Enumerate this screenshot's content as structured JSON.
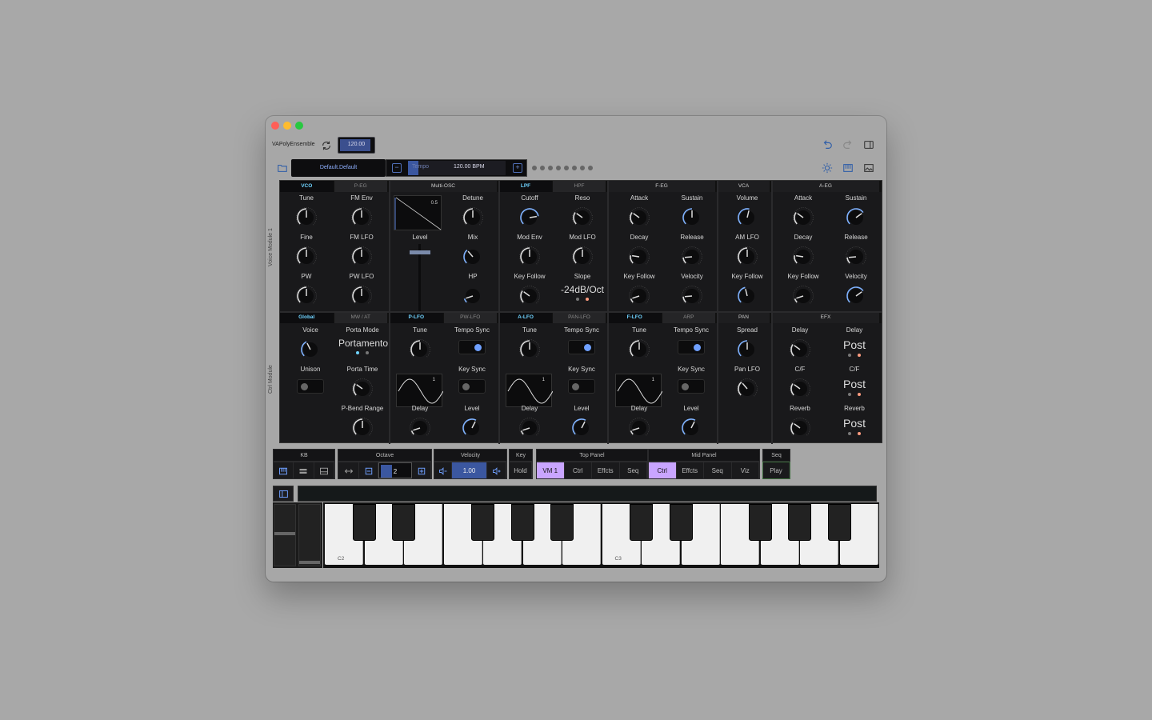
{
  "window": {
    "app_name": "VAPolyEnsemble",
    "tempo_value": "120.00",
    "traffic": {
      "close": "#fe5f57",
      "min": "#febc2e",
      "max": "#28c840"
    }
  },
  "preset": {
    "name": "Default.Default"
  },
  "tempo": {
    "label": "Tempo",
    "value": "120.00 BPM",
    "fill": 0.1
  },
  "page_dots": 8,
  "panel": {
    "side_top": "Voice Module 1",
    "side_bottom": "Ctrl Module",
    "sections_top": [
      {
        "tabs": [
          "VCO",
          "P-EG"
        ],
        "active": 0
      },
      {
        "tabs": [
          "Multi-OSC"
        ],
        "active": -1
      },
      {
        "tabs": [
          "LPF",
          "HPF"
        ],
        "active": 0
      },
      {
        "tabs": [
          "F-EG"
        ],
        "active": -1
      },
      {
        "tabs": [
          "VCA"
        ],
        "active": -1
      },
      {
        "tabs": [
          "A-EG"
        ],
        "active": -1
      }
    ],
    "sections_bottom": [
      {
        "tabs": [
          "Global",
          "MW / AT"
        ],
        "active": 0
      },
      {
        "tabs": [
          "P-LFO",
          "PW-LFO"
        ],
        "active": 0
      },
      {
        "tabs": [
          "A-LFO",
          "PAN-LFO"
        ],
        "active": 0
      },
      {
        "tabs": [
          "F-LFO",
          "ARP"
        ],
        "active": 0
      },
      {
        "tabs": [
          "PAN"
        ],
        "active": -1
      },
      {
        "tabs": [
          "EFX"
        ],
        "active": -1
      }
    ],
    "vco": {
      "tune": "Tune",
      "fm_env": "FM Env",
      "fine": "Fine",
      "fm_lfo": "FM LFO",
      "pw": "PW",
      "pw_lfo": "PW LFO"
    },
    "osc": {
      "shape_value": "0.5",
      "detune": "Detune",
      "level": "Level",
      "mix": "Mix",
      "hp": "HP"
    },
    "lpf": {
      "cutoff": "Cutoff",
      "reso": "Reso",
      "mod_env": "Mod Env",
      "mod_lfo": "Mod LFO",
      "key_follow": "Key Follow",
      "slope": "Slope",
      "slope_value": "-24dB/Oct"
    },
    "feg": {
      "attack": "Attack",
      "sustain": "Sustain",
      "decay": "Decay",
      "release": "Release",
      "key_follow": "Key Follow",
      "velocity": "Velocity"
    },
    "vca": {
      "volume": "Volume",
      "am_lfo": "AM LFO",
      "key_follow": "Key Follow"
    },
    "aeg": {
      "attack": "Attack",
      "sustain": "Sustain",
      "decay": "Decay",
      "release": "Release",
      "key_follow": "Key Follow",
      "velocity": "Velocity"
    },
    "global": {
      "voice": "Voice",
      "porta_mode": "Porta Mode",
      "porta_mode_value": "Portamento",
      "unison": "Unison",
      "porta_time": "Porta Time",
      "pbend": "P-Bend Range"
    },
    "plfo": {
      "tune": "Tune",
      "tempo_sync": "Tempo Sync",
      "key_sync": "Key Sync",
      "delay": "Delay",
      "level": "Level",
      "wave_val": "1"
    },
    "alfo": {
      "tune": "Tune",
      "tempo_sync": "Tempo Sync",
      "key_sync": "Key Sync",
      "delay": "Delay",
      "level": "Level",
      "wave_val": "1"
    },
    "flfo": {
      "tune": "Tune",
      "tempo_sync": "Tempo Sync",
      "key_sync": "Key Sync",
      "delay": "Delay",
      "level": "Level",
      "wave_val": "1"
    },
    "pan": {
      "spread": "Spread",
      "pan_lfo": "Pan LFO"
    },
    "efx": {
      "delay": "Delay",
      "delay2": "Delay",
      "delay_val": "Post",
      "cf": "C/F",
      "cf2": "C/F",
      "cf_val": "Post",
      "reverb": "Reverb",
      "reverb2": "Reverb",
      "reverb_val": "Post"
    }
  },
  "bottom": {
    "kb": "KB",
    "octave": "Octave",
    "octave_value": "2",
    "velocity": "Velocity",
    "velocity_value": "1.00",
    "key": "Key",
    "hold": "Hold",
    "top_panel": "Top Panel",
    "mid_panel": "Mid Panel",
    "seq": "Seq",
    "top_buttons": [
      "VM 1",
      "Ctrl",
      "Effcts",
      "Seq"
    ],
    "mid_buttons": [
      "Ctrl",
      "Effcts",
      "Seq",
      "Viz"
    ],
    "play": "Play"
  },
  "keyboard": {
    "c2": "C2",
    "c3": "C3"
  }
}
